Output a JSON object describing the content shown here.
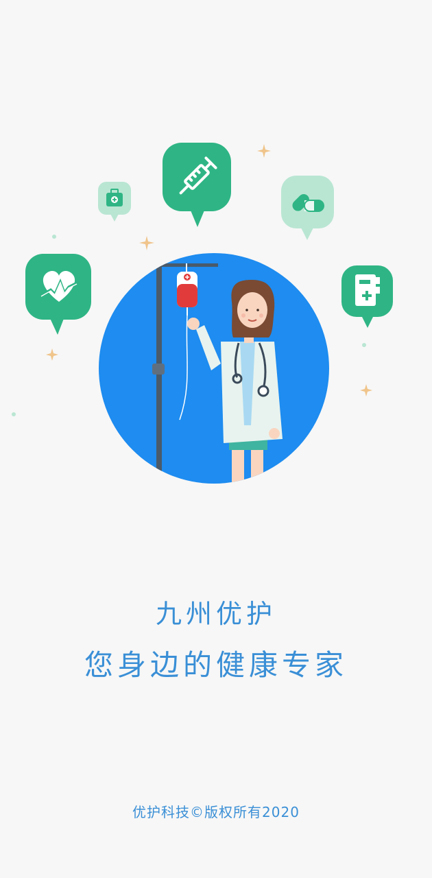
{
  "splash": {
    "app_name": "九州优护",
    "slogan": "您身边的健康专家",
    "copyright": "优护科技©版权所有2020"
  },
  "colors": {
    "background": "#f7f7f7",
    "primary_blue": "#1e8cf0",
    "text_blue": "#3a8fd6",
    "icon_green": "#2fb585",
    "icon_green_light": "#b9e6d3",
    "sparkle": "#f0c48a"
  },
  "icons": [
    "heart-monitor-icon",
    "medical-kit-icon",
    "syringe-icon",
    "pill-capsule-icon",
    "medical-record-icon"
  ]
}
